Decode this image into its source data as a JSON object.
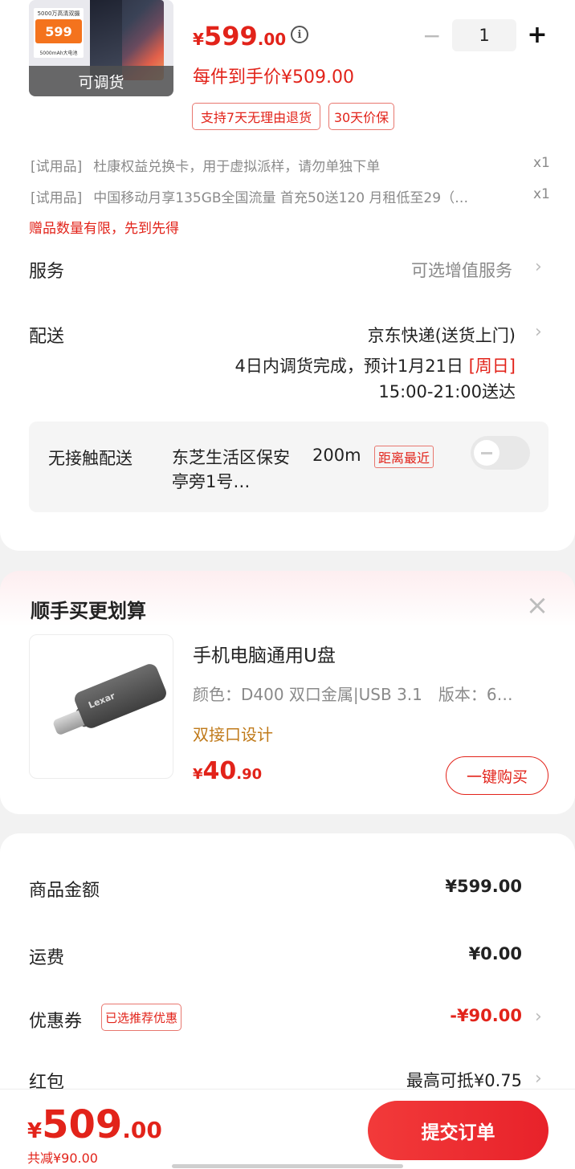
{
  "product": {
    "thumb_promo_top": "5000万高清双摄",
    "thumb_promo_price": "599",
    "thumb_promo_bottom": "5000mAh大电池",
    "thumb_overlay": "可调货",
    "price_symbol": "¥",
    "price_int": "599",
    "price_dec": ".00",
    "arrive_price": "每件到手价¥509.00",
    "quantity": "1",
    "minus": "−",
    "plus": "+",
    "tags": [
      "支持7天无理由退货",
      "30天价保"
    ]
  },
  "gifts": [
    {
      "label": "[试用品]",
      "text": "杜康权益兑换卡，用于虚拟派样，请勿单独下单",
      "qty": "x1"
    },
    {
      "label": "[试用品]",
      "text": "中国移动月享135GB全国流量 首充50送120 月租低至29（…",
      "qty": "x1"
    }
  ],
  "gift_note": "赠品数量有限，先到先得",
  "service": {
    "label": "服务",
    "value": "可选增值服务"
  },
  "delivery": {
    "label": "配送",
    "method": "京东快递(送货上门)",
    "time_line1": "4日内调货完成，预计1月21日",
    "time_day": "[周日]",
    "time_line2": "15:00-21:00送达"
  },
  "contactless": {
    "label": "无接触配送",
    "location": "东芝生活区保安亭旁1号…",
    "distance": "200m",
    "tag": "距离最近",
    "enabled": false
  },
  "recommend": {
    "title": "顺手买更划算",
    "close": "×",
    "name": "手机电脑通用U盘",
    "spec": "颜色：D400 双口金属|USB 3.1　版本：6…",
    "feature": "双接口设计",
    "price_symbol": "¥",
    "price_int": "40",
    "price_dec": ".90",
    "buy_label": "一键购买",
    "image_brand": "Lexar"
  },
  "summary": {
    "goods_label": "商品金额",
    "goods_value": "¥599.00",
    "shipping_label": "运费",
    "shipping_value": "¥0.00",
    "coupon_label": "优惠券",
    "coupon_tag": "已选推荐优惠",
    "coupon_value": "-¥90.00",
    "redpacket_label": "红包",
    "redpacket_value": "最高可抵¥0.75"
  },
  "bottom": {
    "total_symbol": "¥",
    "total_int": "509",
    "total_dec": ".00",
    "saved": "共减¥90.00",
    "submit": "提交订单"
  },
  "colors": {
    "accent": "#e2231a",
    "feature": "#c07a1a",
    "muted": "#8a8a8a"
  }
}
